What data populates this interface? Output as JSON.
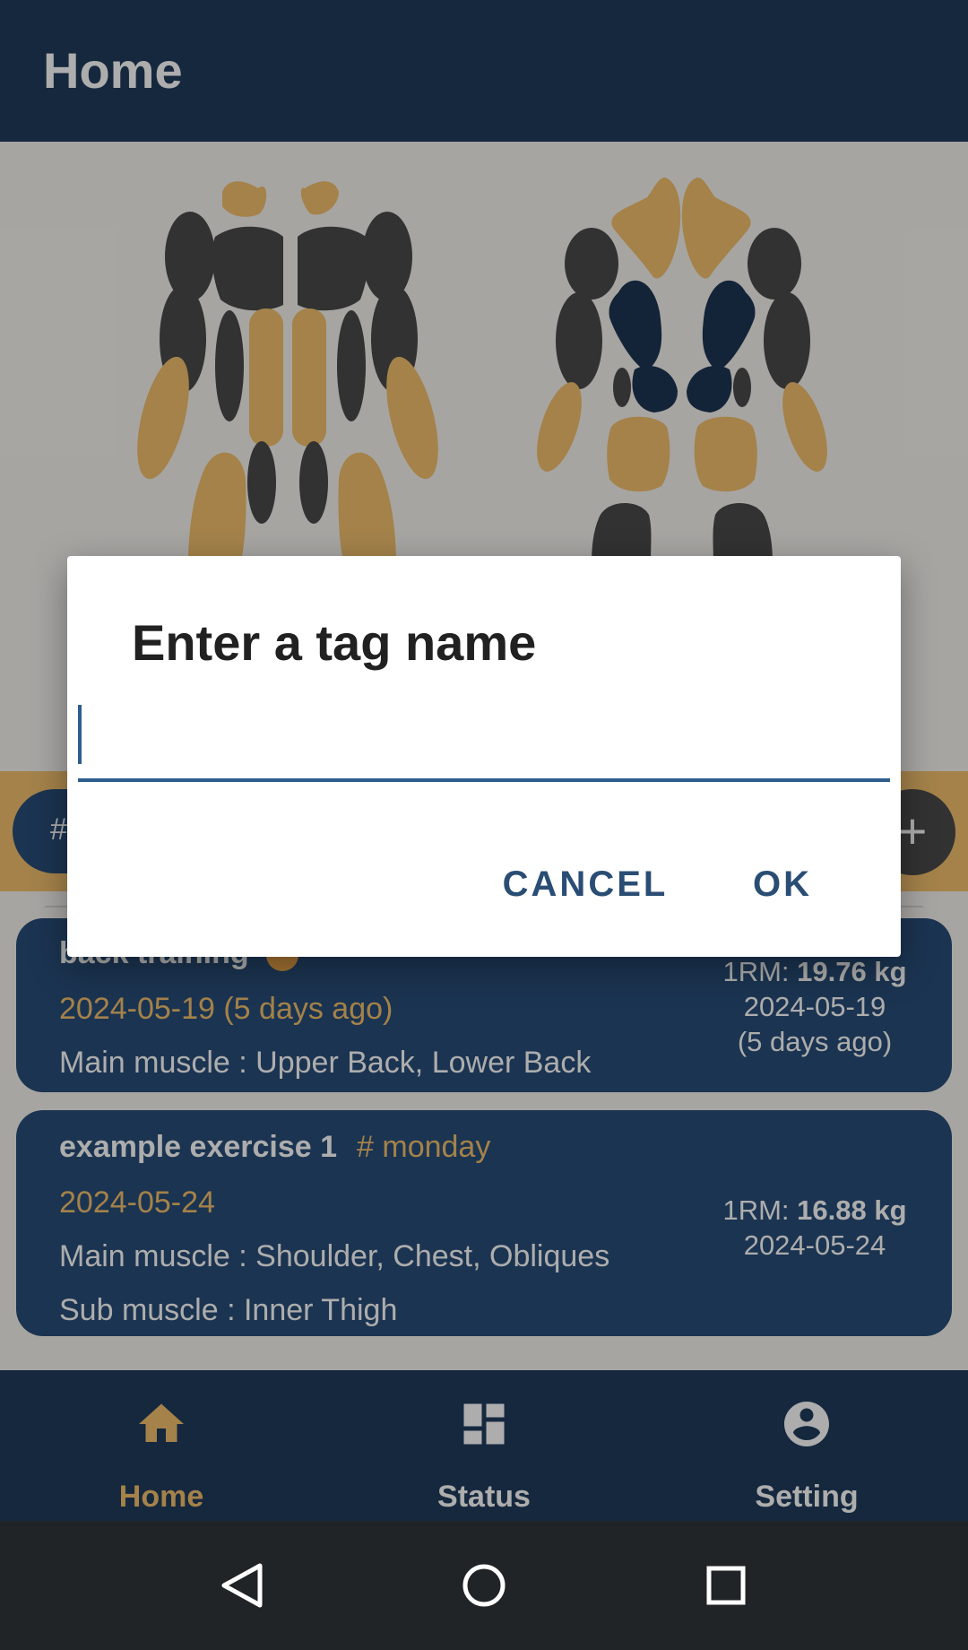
{
  "topbar": {
    "title": "Home"
  },
  "tagbar": {
    "chip_hash": "#",
    "add_symbol": "+"
  },
  "exercises": [
    {
      "name": "back training",
      "date": "2024-05-19 (5 days ago)",
      "main_muscle": "Main muscle : Upper Back, Lower Back",
      "rm_label": "1RM: ",
      "rm_value": "19.76 kg",
      "rm_date": "2024-05-19",
      "rm_ago": "(5 days ago)"
    },
    {
      "name": "example exercise 1",
      "tag": "# monday",
      "date": "2024-05-24",
      "main_muscle": "Main muscle : Shoulder, Chest, Obliques",
      "sub_muscle": "Sub muscle : Inner Thigh",
      "rm_label": "1RM: ",
      "rm_value": "16.88 kg",
      "rm_date": "2024-05-24"
    }
  ],
  "bottom_nav": {
    "items": [
      {
        "label": "Home",
        "icon": "home-icon",
        "active": true
      },
      {
        "label": "Status",
        "icon": "dashboard-icon",
        "active": false
      },
      {
        "label": "Setting",
        "icon": "account-circle-icon",
        "active": false
      }
    ]
  },
  "dialog": {
    "title": "Enter a tag name",
    "input_value": "",
    "cancel_label": "CANCEL",
    "ok_label": "OK"
  },
  "colors": {
    "primary_dark": "#1f3b5c",
    "card_blue": "#284d78",
    "accent_gold": "#f2c06e",
    "muscle_gray": "#4a4a4a",
    "dialog_button": "#2a4d74"
  }
}
